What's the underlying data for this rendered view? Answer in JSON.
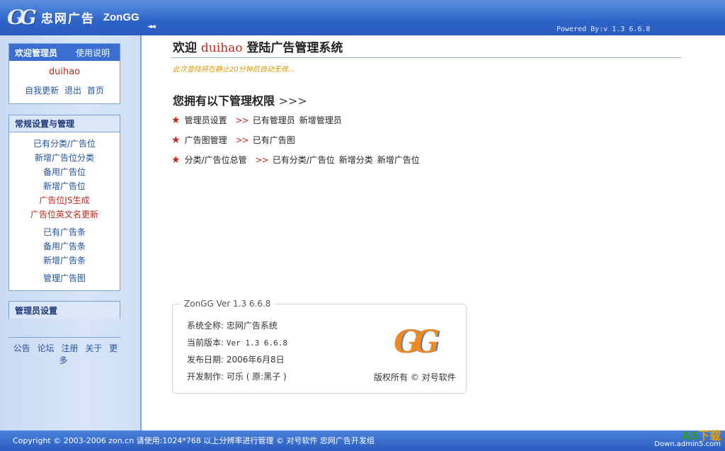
{
  "header": {
    "logo_mark": "GG",
    "title_cn": "忠网广告",
    "title_en": "ZonGG",
    "collapse": "◄◄",
    "powered_by": "Powered By:v 1.3 6.6.8"
  },
  "sidebar": {
    "welcome_box": {
      "title": "欢迎管理员",
      "help": "使用说明",
      "username": "duihao",
      "links": [
        "自我更新",
        "退出",
        "首页"
      ]
    },
    "settings_box": {
      "title": "常规设置与管理",
      "items": [
        {
          "label": "已有分类/广告位",
          "red": false
        },
        {
          "label": "新增广告位分类",
          "red": false
        },
        {
          "label": "备用广告位",
          "red": false
        },
        {
          "label": "新增广告位",
          "red": false
        },
        {
          "label": "广告位JS生成",
          "red": true
        },
        {
          "label": "广告位英文名更新",
          "red": true
        },
        {
          "label": "已有广告条",
          "red": false
        },
        {
          "label": "备用广告条",
          "red": false
        },
        {
          "label": "新增广告条",
          "red": false
        },
        {
          "label": "管理广告图",
          "red": false
        }
      ]
    },
    "admin_box": {
      "title": "管理员设置"
    },
    "bottom_links": [
      "公告",
      "论坛",
      "注册",
      "关于",
      "更多"
    ]
  },
  "main": {
    "welcome_prefix": "欢迎",
    "welcome_user": "duihao",
    "welcome_suffix": "登陆广告管理系统",
    "notice": "此次登陆将在静止20分钟后自动无效...",
    "perm_title": "您拥有以下管理权限",
    "perm_arrows": ">>>",
    "permissions": [
      {
        "group": "管理员设置",
        "links": [
          "已有管理员",
          "新增管理员"
        ]
      },
      {
        "group": "广告图管理",
        "links": [
          "已有广告图"
        ]
      },
      {
        "group": "分类/广告位总管",
        "links": [
          "已有分类/广告位",
          "新增分类",
          "新增广告位"
        ]
      }
    ],
    "sep": ">>",
    "info": {
      "legend": "ZonGG Ver 1.3 6.6.8",
      "rows": [
        {
          "label": "系统全称:",
          "value": "忠网广告系统"
        },
        {
          "label": "当前版本:",
          "value": "Ver 1.3 6.6.8"
        },
        {
          "label": "发布日期:",
          "value": "2006年6月8日"
        },
        {
          "label": "开发制作:",
          "value": "可乐 ( 原:黑子 )"
        }
      ],
      "logo": "GG",
      "copyright": "版权所有 © 对号软件"
    }
  },
  "footer": {
    "text": "Copyright © 2003-2006 zon.cn 请使用:1024*768 以上分辨率进行管理 © 对号软件 忠网广告开发组",
    "watermark_a": "A5",
    "watermark_b": "下载",
    "watermark_site": "Down.admin5.com"
  }
}
